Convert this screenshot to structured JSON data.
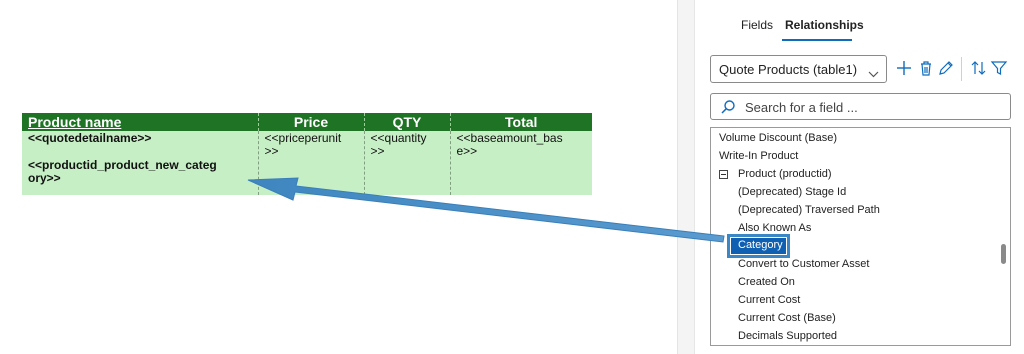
{
  "document": {
    "headers": [
      "Product name",
      "Price",
      "QTY",
      "Total"
    ],
    "row": {
      "col0_line1": "<<quotedetailname>>",
      "col0_line2": "<<productid_product_new_categ",
      "col0_line3": "ory>>",
      "col1_line1": "<<priceperunit",
      "col1_line2": ">>",
      "col2_line1": "<<quantity",
      "col2_line2": ">>",
      "col3_line1": "<<baseamount_bas",
      "col3_line2": "e>>"
    }
  },
  "panel": {
    "tabs": {
      "fields": "Fields",
      "relationships": "Relationships"
    },
    "table_select": {
      "value": "Quote Products (table1)"
    },
    "search": {
      "placeholder": "Search for a field ..."
    },
    "fields": [
      "Volume Discount (Base)",
      "Write-In Product",
      "Product (productid)",
      "(Deprecated) Stage Id",
      "(Deprecated) Traversed Path",
      "Also Known As",
      "Category",
      "Convert to Customer Asset",
      "Created On",
      "Current Cost",
      "Current Cost (Base)",
      "Decimals Supported"
    ],
    "selected_field": "Category",
    "accent_color": "#0f6cbd",
    "icons": [
      "chevron-down-icon",
      "add-icon",
      "delete-icon",
      "edit-icon",
      "sort-icon",
      "filter-icon",
      "search-icon",
      "collapse-icon"
    ]
  }
}
